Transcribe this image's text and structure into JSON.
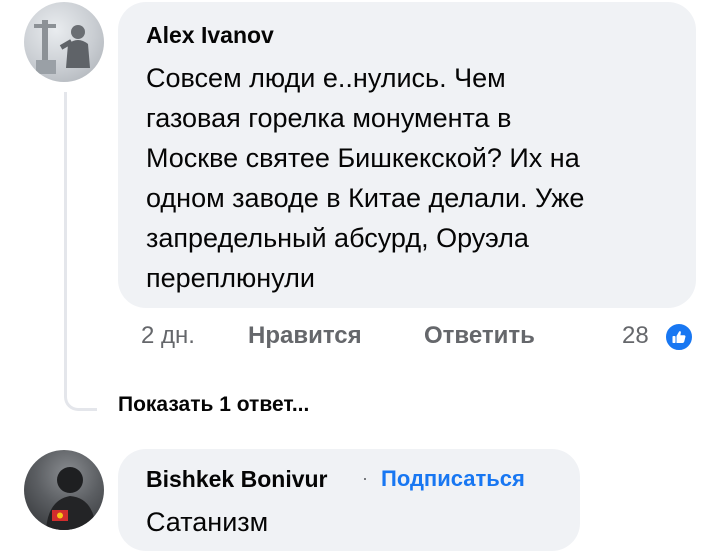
{
  "comments": [
    {
      "author": "Alex Ivanov",
      "text": "Совсем люди е..нулись. Чем\nгазовая горелка монумента в\nМоскве святее Бишкекской? Их на\nодном заводе в Китае делали. Уже\nзапредельный абсурд, Оруэла\nпереплюнули",
      "time": "2 дн.",
      "like_label": "Нравится",
      "reply_label": "Ответить",
      "reactions_count": "28",
      "reaction_icon": "like-thumb-icon",
      "show_replies_label": "Показать 1 ответ..."
    },
    {
      "author": "Bishkek Bonivur",
      "separator": "·",
      "follow_label": "Подписаться",
      "text": "Сатанизм"
    }
  ],
  "colors": {
    "bubble": "#f0f2f5",
    "link": "#1877f2",
    "meta": "#65676b",
    "thread_line": "#e4e6eb"
  }
}
